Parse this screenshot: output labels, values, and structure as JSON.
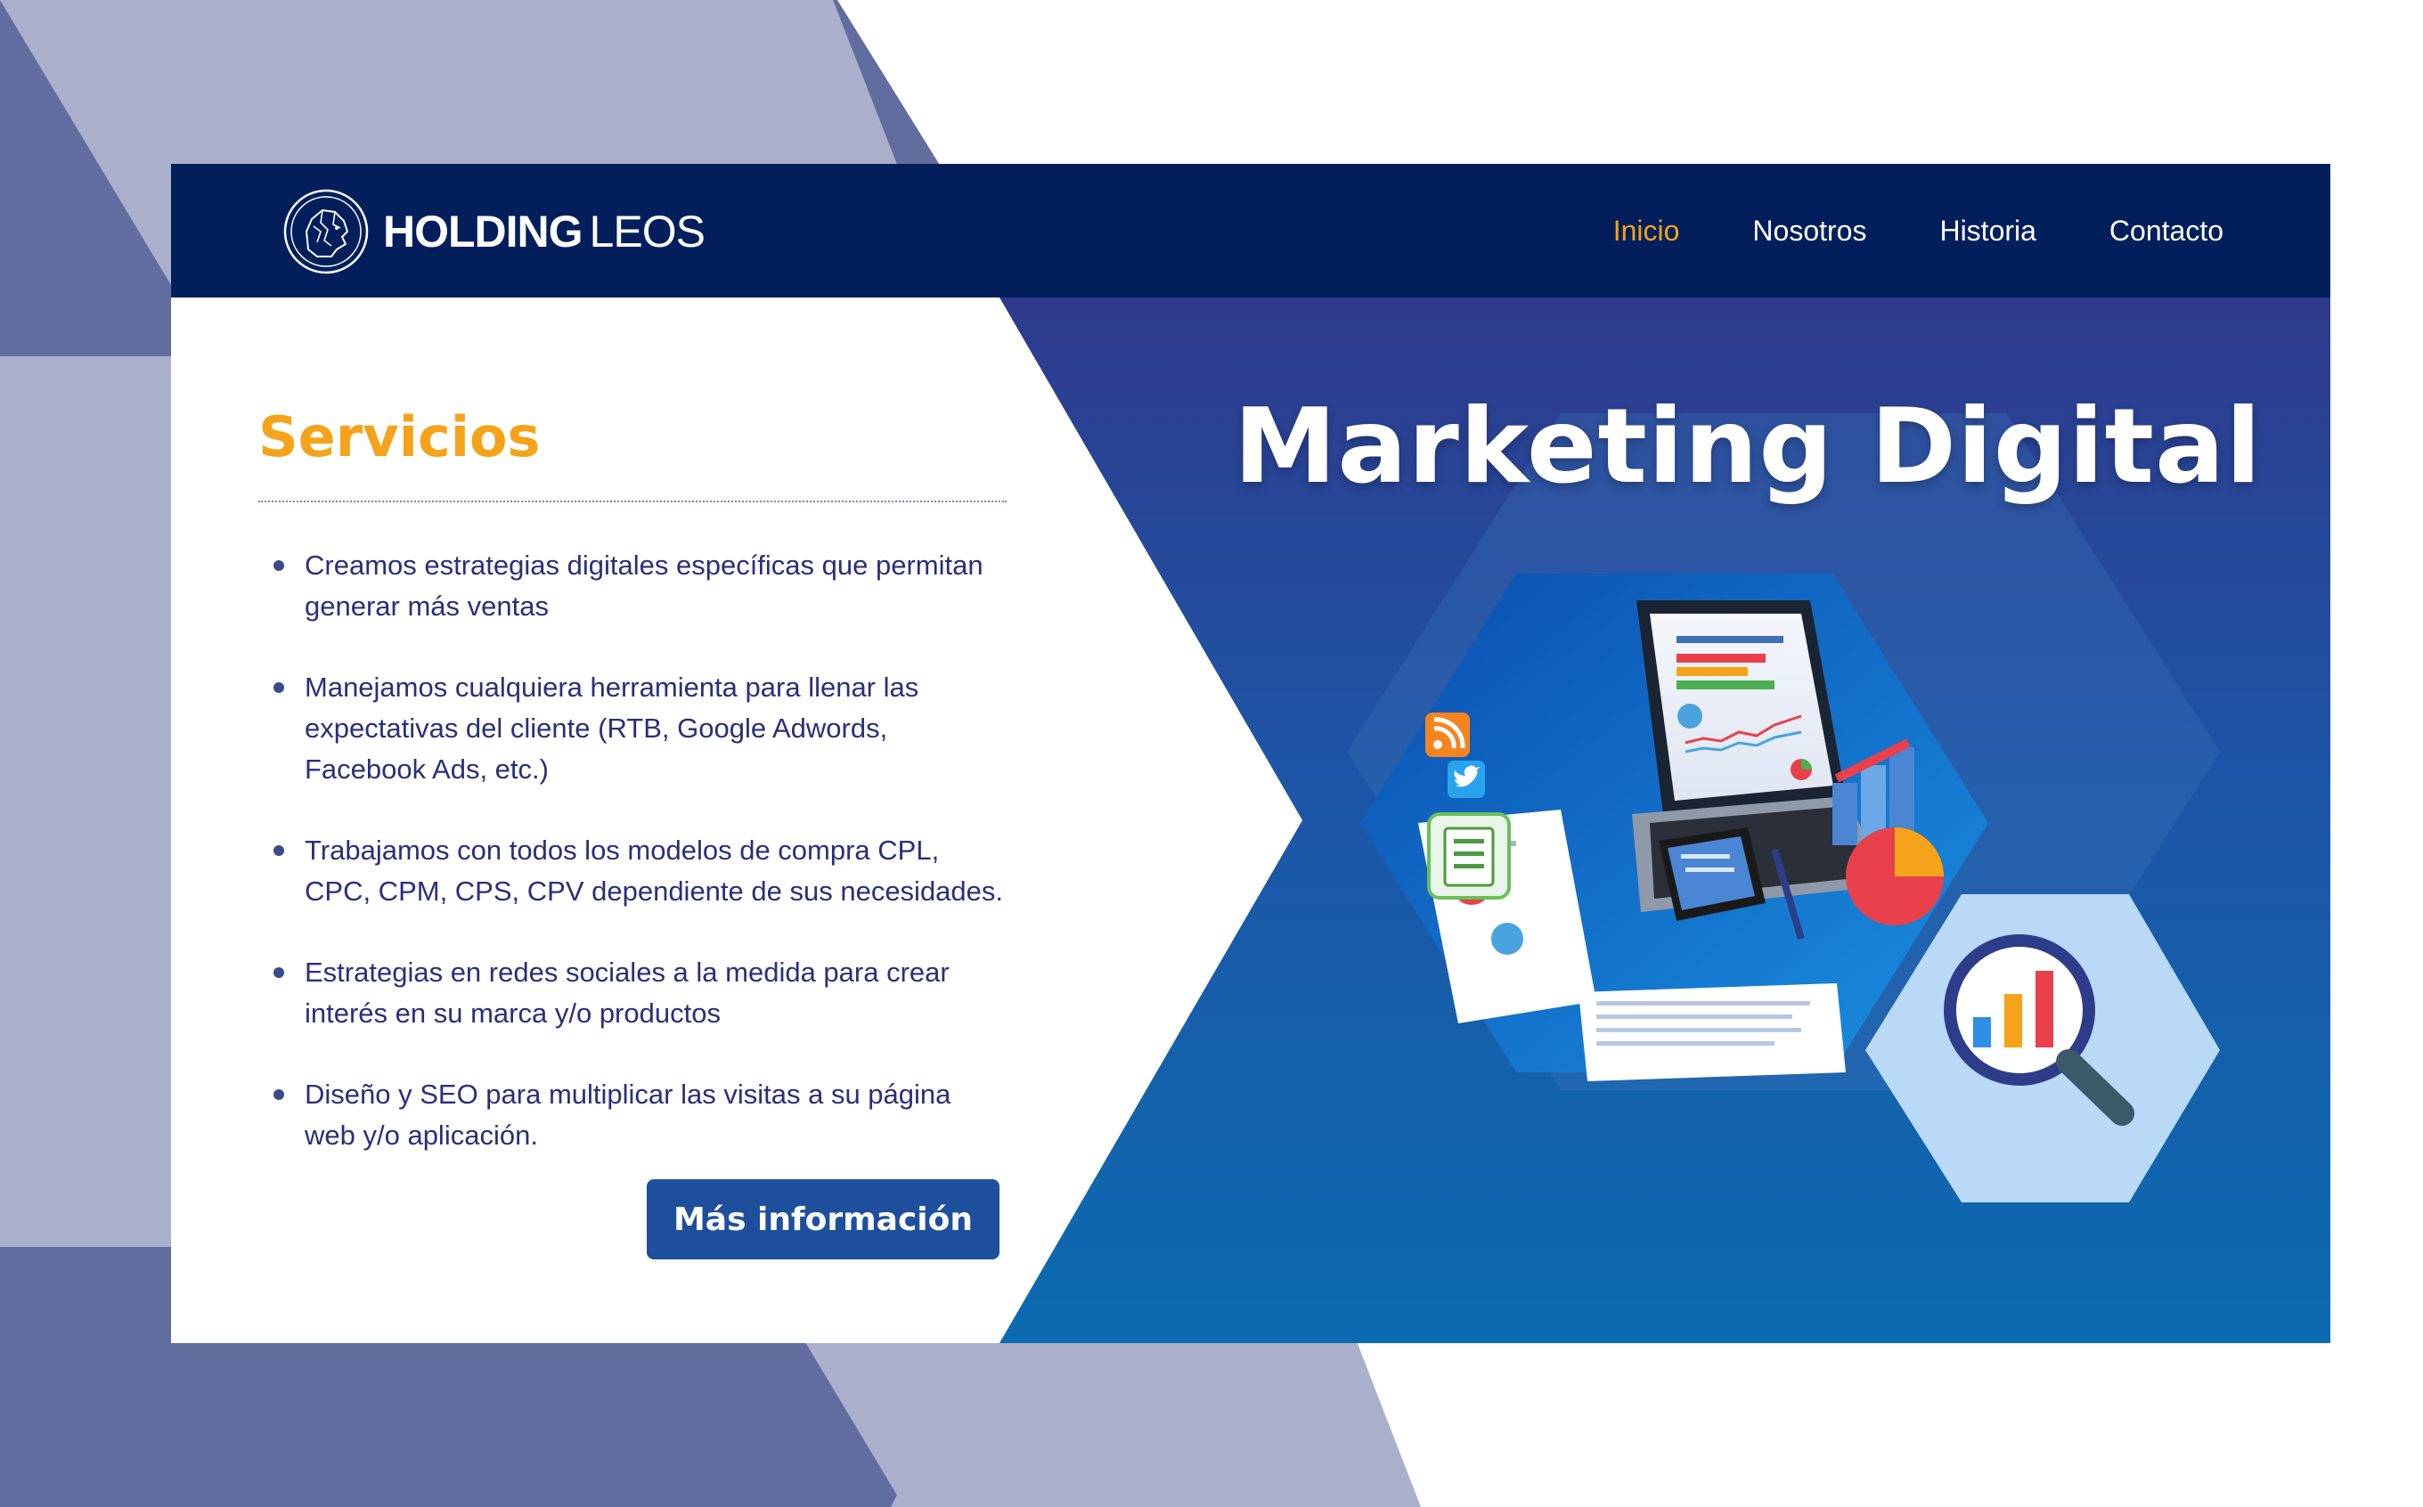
{
  "brand": {
    "name_bold": "HOLDING",
    "name_light": "LEOS"
  },
  "nav": {
    "items": [
      {
        "label": "Inicio",
        "active": true
      },
      {
        "label": "Nosotros",
        "active": false
      },
      {
        "label": "Historia",
        "active": false
      },
      {
        "label": "Contacto",
        "active": false
      }
    ]
  },
  "services": {
    "title": "Servicios",
    "items": [
      "Creamos estrategias digitales específicas que permitan generar más ventas",
      "Manejamos cualquiera herramienta para llenar las expectativas del cliente (RTB, Google Adwords, Facebook Ads, etc.)",
      "Trabajamos con todos los modelos de compra CPL, CPC, CPM, CPS, CPV dependiente de sus necesidades.",
      "Estrategias en redes sociales a la medida para crear interés en su marca y/o productos",
      "Diseño y SEO para multiplicar las visitas a su página web y/o aplicación."
    ],
    "cta_label": "Más información"
  },
  "hero": {
    "title": "Marketing Digital"
  },
  "icons": {
    "logo": "lion-head-logo-icon",
    "rss": "rss-icon",
    "twitter": "twitter-bird-icon",
    "notepad": "notepad-icon",
    "analytics": "magnifier-bar-chart-icon"
  },
  "colors": {
    "header": "#021f5c",
    "accent": "#f5a31a",
    "text": "#2a2f7a",
    "button": "#1e4f9c",
    "bg_dark": "#626d9f",
    "bg_light": "#aab0cc"
  }
}
